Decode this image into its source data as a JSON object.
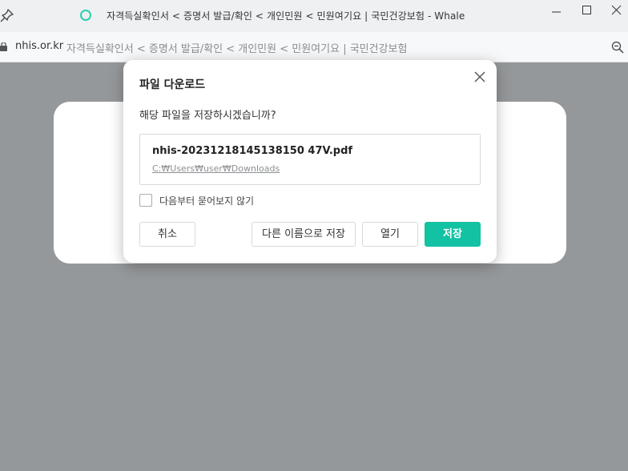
{
  "window": {
    "title": "자격득실확인서 < 증명서 발급/확인 < 개인민원 < 민원여기요 | 국민건강보험 - Whale",
    "icons": [
      "pin-icon",
      "whale-logo-icon",
      "minimize-icon",
      "maximize-icon",
      "close-icon"
    ]
  },
  "address_bar": {
    "domain": "nhis.or.kr",
    "page_title": "자격득실확인서 < 증명서 발급/확인 < 개인민원 < 민원여기요 | 국민건강보험",
    "icons": [
      "lock-icon",
      "zoom-icon"
    ]
  },
  "dialog": {
    "title": "파일 다운로드",
    "question": "해당 파일을 저장하시겠습니까?",
    "file_name": "nhis-20231218145138150 47V.pdf",
    "file_path": "C:₩Users₩user₩Downloads",
    "checkbox_label": "다음부터 묻어보지 않기",
    "checkbox_checked": false,
    "buttons": {
      "cancel": "취소",
      "save_as": "다른 이름으로 저장",
      "open": "열기",
      "save": "저장"
    },
    "accent_color": "#13c2a3"
  },
  "colors": {
    "overlay": "#95989a",
    "titlebar": "#eef0f2",
    "whale_logo": "#2ccfae"
  }
}
